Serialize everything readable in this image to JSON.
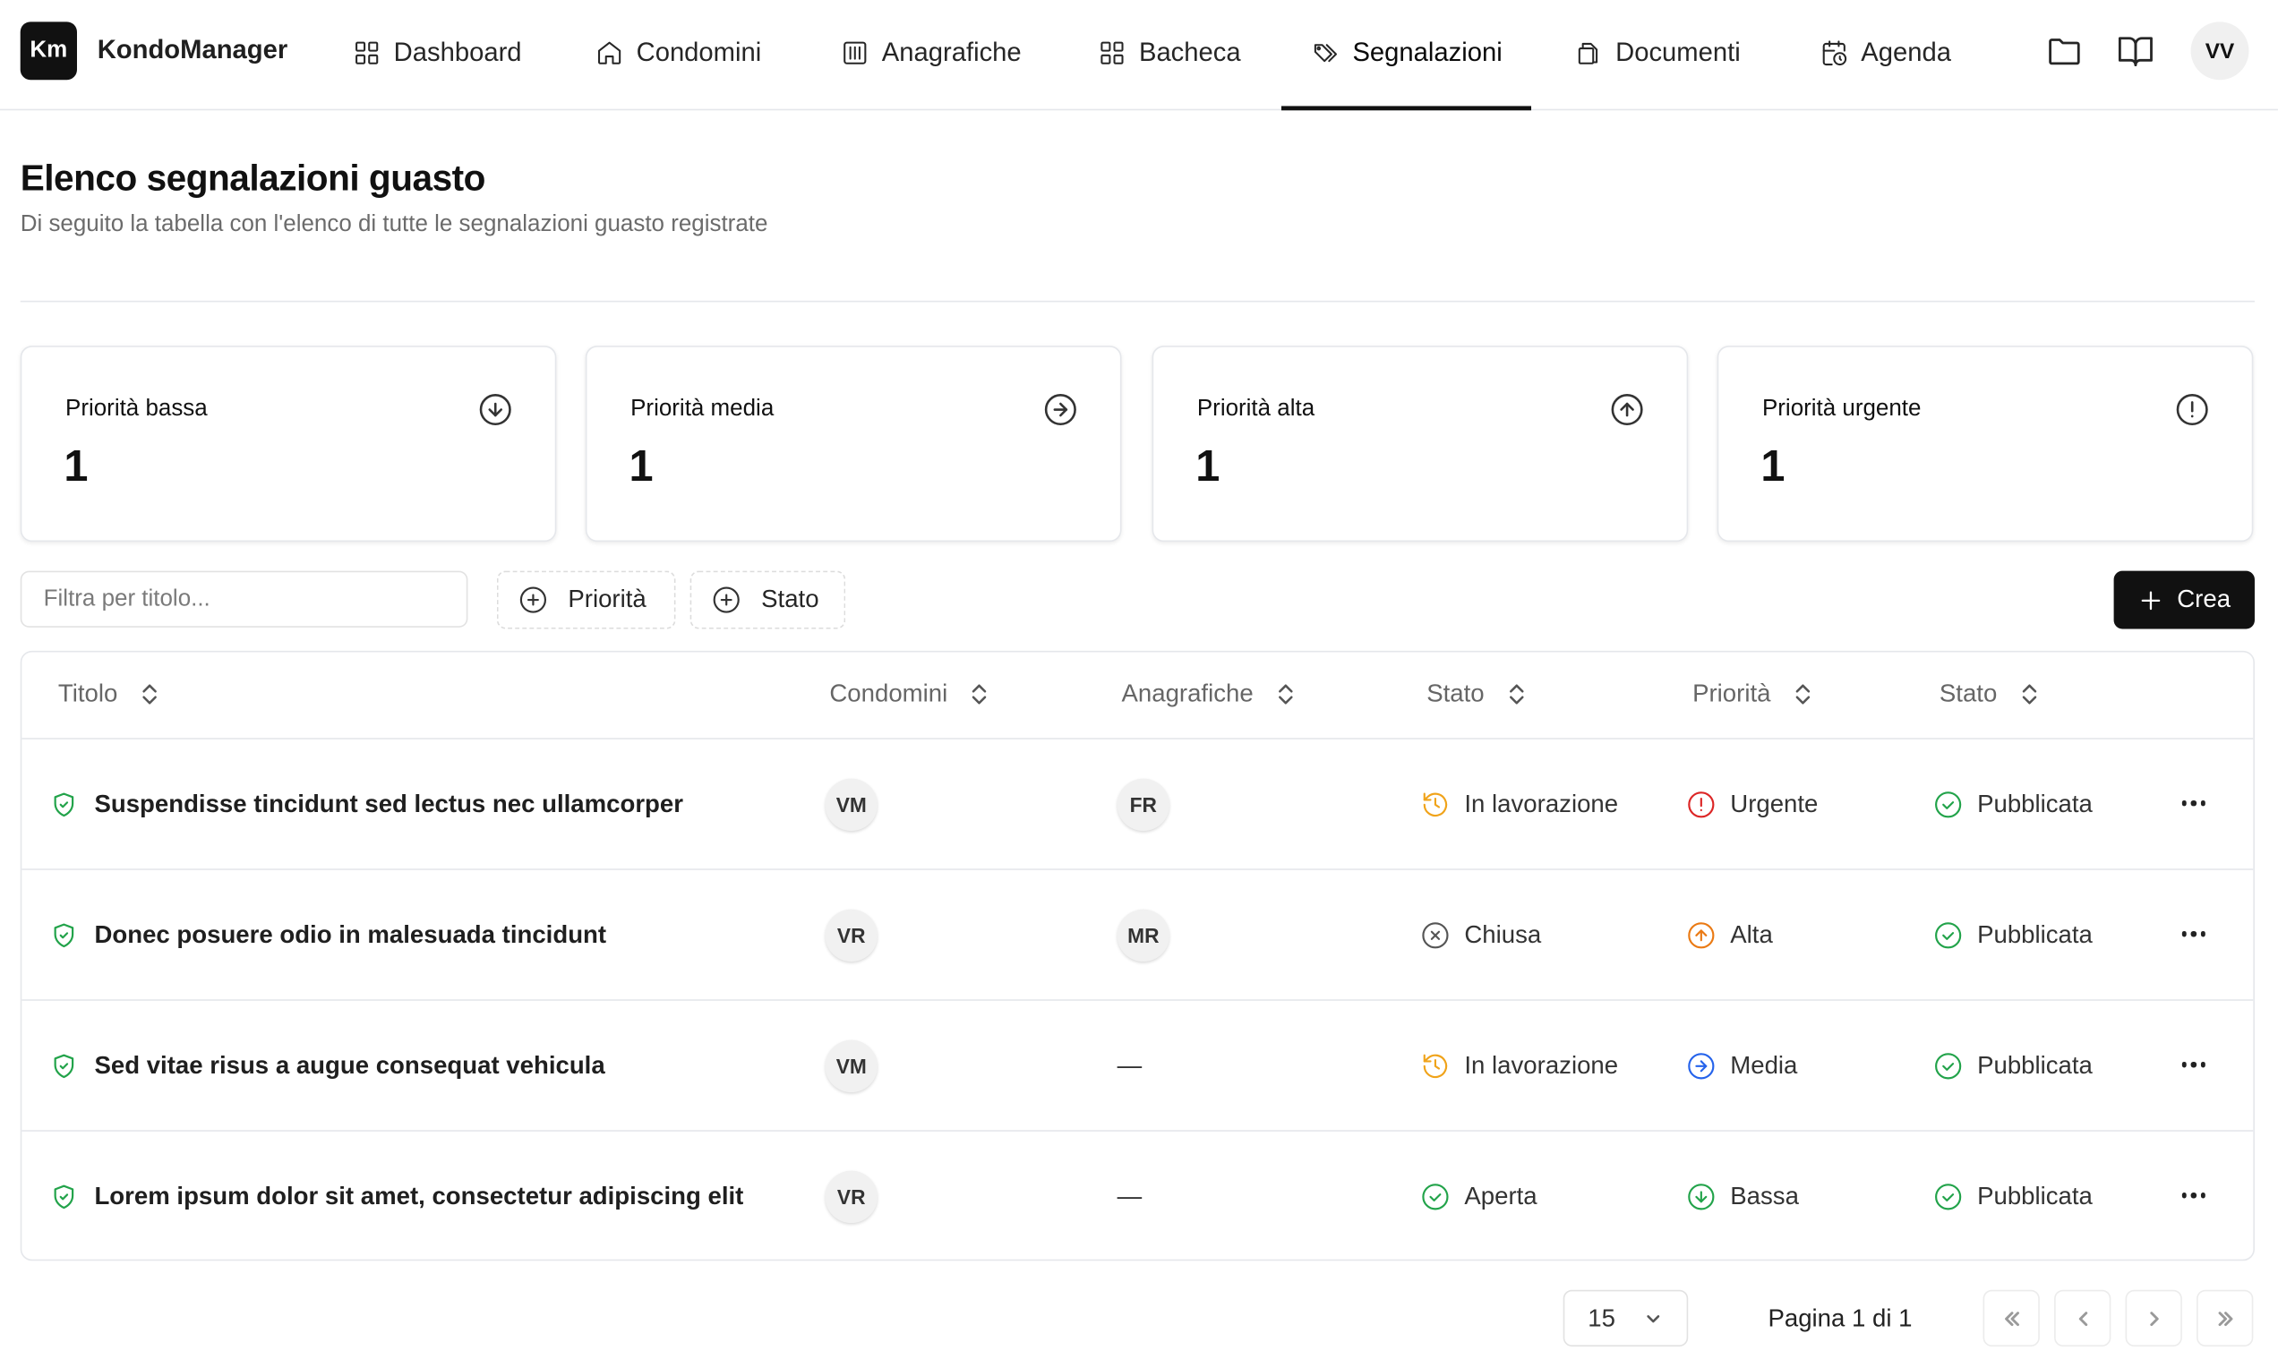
{
  "app": {
    "logo_text": "Km",
    "name": "KondoManager",
    "user_initials": "VV"
  },
  "nav": {
    "items": [
      {
        "label": "Dashboard",
        "icon": "grid-icon"
      },
      {
        "label": "Condomini",
        "icon": "home-icon"
      },
      {
        "label": "Anagrafiche",
        "icon": "columns-icon"
      },
      {
        "label": "Bacheca",
        "icon": "grid-icon"
      },
      {
        "label": "Segnalazioni",
        "icon": "tags-icon",
        "active": true
      },
      {
        "label": "Documenti",
        "icon": "files-icon"
      },
      {
        "label": "Agenda",
        "icon": "calendar-clock-icon"
      }
    ],
    "right_icons": [
      "folder-icon",
      "book-open-icon"
    ]
  },
  "header": {
    "title": "Elenco segnalazioni guasto",
    "subtitle": "Di seguito la tabella con l'elenco di tutte le segnalazioni guasto registrate"
  },
  "cards": [
    {
      "label": "Priorità bassa",
      "value": "1",
      "icon": "arrow-down-circle-icon"
    },
    {
      "label": "Priorità media",
      "value": "1",
      "icon": "arrow-right-circle-icon"
    },
    {
      "label": "Priorità alta",
      "value": "1",
      "icon": "arrow-up-circle-icon"
    },
    {
      "label": "Priorità urgente",
      "value": "1",
      "icon": "alert-circle-icon"
    }
  ],
  "toolbar": {
    "filter_placeholder": "Filtra per titolo...",
    "filter_value": "",
    "chip_priority": "Priorità",
    "chip_status": "Stato",
    "create_label": "Crea"
  },
  "table": {
    "columns": [
      "Titolo",
      "Condomini",
      "Anagrafiche",
      "Stato",
      "Priorità",
      "Stato"
    ],
    "rows": [
      {
        "title": "Suspendisse tincidunt sed lectus nec ullamcorper",
        "condominio": "VM",
        "anagrafica": "FR",
        "stato": "In lavorazione",
        "priorita": "Urgente",
        "pubblicazione": "Pubblicata"
      },
      {
        "title": "Donec posuere odio in malesuada tincidunt",
        "condominio": "VR",
        "anagrafica": "MR",
        "stato": "Chiusa",
        "priorita": "Alta",
        "pubblicazione": "Pubblicata"
      },
      {
        "title": "Sed vitae risus a augue consequat vehicula",
        "condominio": "VM",
        "anagrafica": "—",
        "stato": "In lavorazione",
        "priorita": "Media",
        "pubblicazione": "Pubblicata"
      },
      {
        "title": "Lorem ipsum dolor sit amet, consectetur adipiscing elit",
        "condominio": "VR",
        "anagrafica": "—",
        "stato": "Aperta",
        "priorita": "Bassa",
        "pubblicazione": "Pubblicata"
      }
    ]
  },
  "pagination": {
    "rows_per_page": "15",
    "page_label": "Pagina 1 di 1"
  },
  "colors": {
    "primary": "#111111",
    "border": "#e5e7eb",
    "green": "#22a34a",
    "orange": "#ea7a14",
    "amber": "#f0a31a",
    "red": "#dc2626",
    "blue": "#2563eb",
    "gray": "#555555"
  }
}
